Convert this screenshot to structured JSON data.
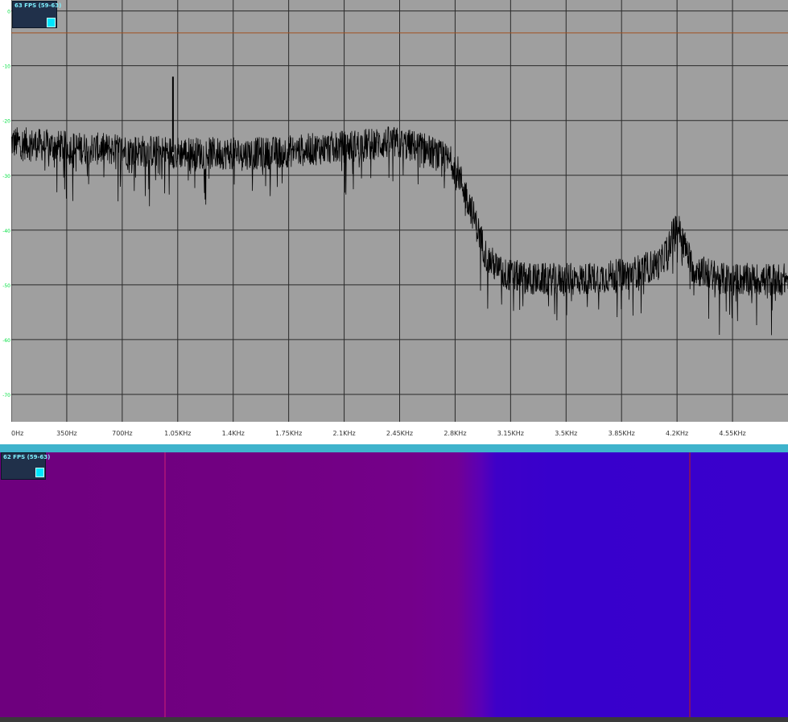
{
  "spectrum": {
    "fps_label": "63 FPS (59-63)",
    "frequency_ticks": [
      "0Hz",
      "350Hz",
      "700Hz",
      "1.05KHz",
      "1.4KHz",
      "1.75KHz",
      "2.1KHz",
      "2.45KHz",
      "2.8KHz",
      "3.15KHz",
      "3.5KHz",
      "3.85KHz",
      "4.2KHz",
      "4.55KHz"
    ],
    "level_ticks": [
      "0",
      "-10",
      "-20",
      "-30",
      "-40",
      "-50",
      "-60",
      "-70"
    ],
    "colors": {
      "background": "#9f9f9f",
      "grid": "#2a2a2a",
      "trace": "#000000",
      "reference_line": "#a05020",
      "tick_text": "#00e040"
    }
  },
  "waterfall": {
    "fps_label": "62 FPS (59-63)",
    "colors": {
      "low_band": "#720082",
      "high_band": "#3a00cc",
      "tone_line": "#a0107a"
    }
  },
  "chart_data": {
    "type": "line",
    "x_unit": "Hz",
    "xlim": [
      0,
      4900
    ],
    "ylim": [
      -75,
      2
    ],
    "series": [
      {
        "points": [
          [
            0,
            -24
          ],
          [
            400,
            -25
          ],
          [
            800,
            -25.5
          ],
          [
            1200,
            -26
          ],
          [
            1600,
            -26
          ],
          [
            2000,
            -25
          ],
          [
            2400,
            -24
          ],
          [
            2600,
            -25
          ],
          [
            2800,
            -28
          ],
          [
            2900,
            -36
          ],
          [
            3000,
            -45
          ],
          [
            3100,
            -48
          ],
          [
            3300,
            -49
          ],
          [
            3600,
            -49
          ],
          [
            3900,
            -48
          ],
          [
            4100,
            -46
          ],
          [
            4200,
            -39
          ],
          [
            4300,
            -47
          ],
          [
            4500,
            -49
          ],
          [
            4900,
            -49
          ]
        ]
      }
    ],
    "peaks": [
      {
        "x": 1020,
        "y": -12
      },
      {
        "x": 4200,
        "y": -39
      }
    ]
  }
}
